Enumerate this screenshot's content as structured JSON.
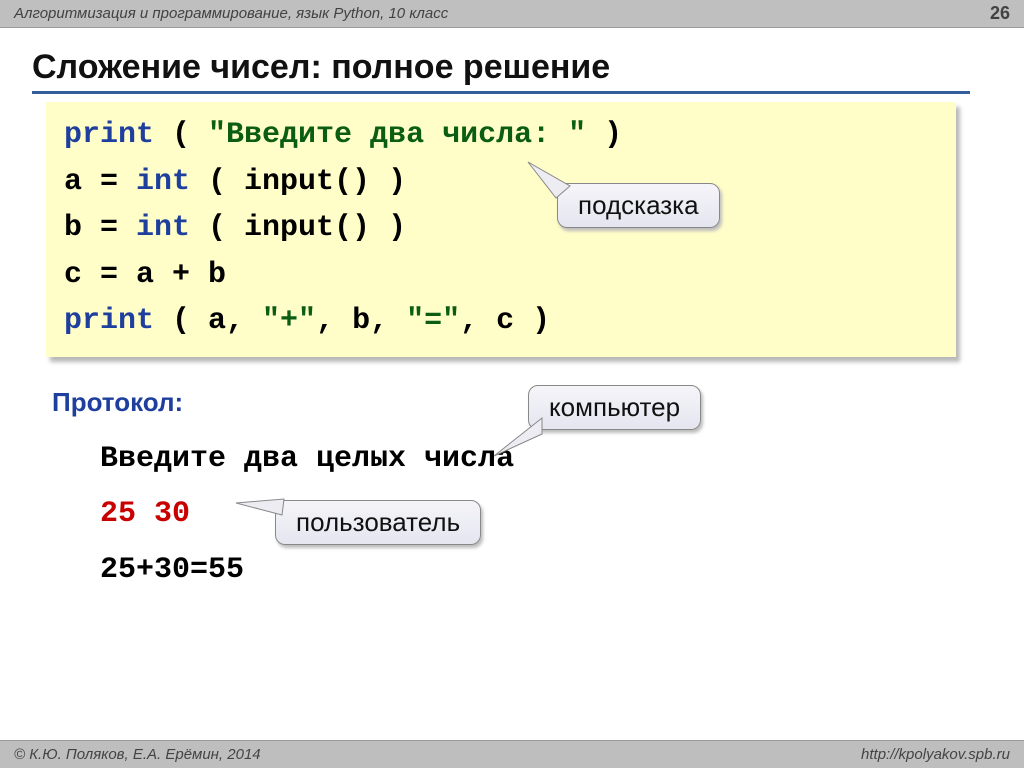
{
  "header": {
    "subject": "Алгоритмизация и программирование, язык Python, 10 класс",
    "page": "26"
  },
  "title": "Сложение чисел: полное решение",
  "code": {
    "l1_kw": "print",
    "l1_paren": " ( ",
    "l1_str": "\"Введите два числа: \"",
    "l1_end": " )",
    "l2_pre": "a = ",
    "l2_kw": "int",
    "l2_rest": " ( input() )",
    "l3_pre": "b = ",
    "l3_kw": "int",
    "l3_rest": " ( input() )",
    "l4": "c = a + b",
    "l5_kw": "print",
    "l5_p1": " ( a, ",
    "l5_s1": "\"+\"",
    "l5_p2": ", b, ",
    "l5_s2": "\"=\"",
    "l5_p3": ", c )"
  },
  "callouts": {
    "hint": "подсказка",
    "computer": "компьютер",
    "user": "пользователь"
  },
  "protocol": {
    "label": "Протокол:",
    "line1": "Введите два целых числа",
    "line2": "25 30",
    "line3": "25+30=55"
  },
  "footer": {
    "copyright": "© К.Ю. Поляков, Е.А. Ерёмин, 2014",
    "url": "http://kpolyakov.spb.ru"
  }
}
